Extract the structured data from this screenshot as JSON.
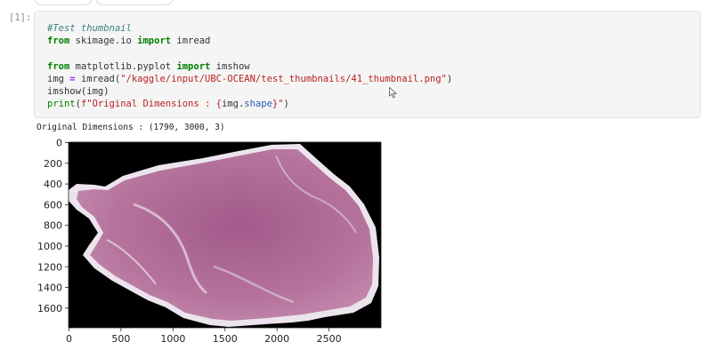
{
  "cell": {
    "prompt": "[1]:",
    "code": {
      "line1_comment": "#Test thumbnail",
      "line2": [
        "from",
        " skimage.io ",
        "import",
        " imread"
      ],
      "line4": [
        "from",
        " matplotlib.pyplot ",
        "import",
        " imshow"
      ],
      "line5": [
        "img ",
        "=",
        " imread(",
        "\"/kaggle/input/UBC-OCEAN/test_thumbnails/41_thumbnail.png\"",
        ")"
      ],
      "line6": "imshow(img)",
      "line7": [
        "print",
        "(",
        "f\"Original Dimensions : {",
        "img",
        ".",
        "shape",
        "}\"",
        ")"
      ]
    }
  },
  "output": {
    "text": "Original Dimensions : (1790, 3000, 3)"
  },
  "plot": {
    "x_ticks": [
      "0",
      "500",
      "1000",
      "1500",
      "2000",
      "2500"
    ],
    "y_ticks": [
      "0",
      "200",
      "400",
      "600",
      "800",
      "1000",
      "1200",
      "1400",
      "1600"
    ],
    "image_background": "#000000",
    "tissue_fill": "#b26e98",
    "tissue_border": "#ece4ec"
  }
}
